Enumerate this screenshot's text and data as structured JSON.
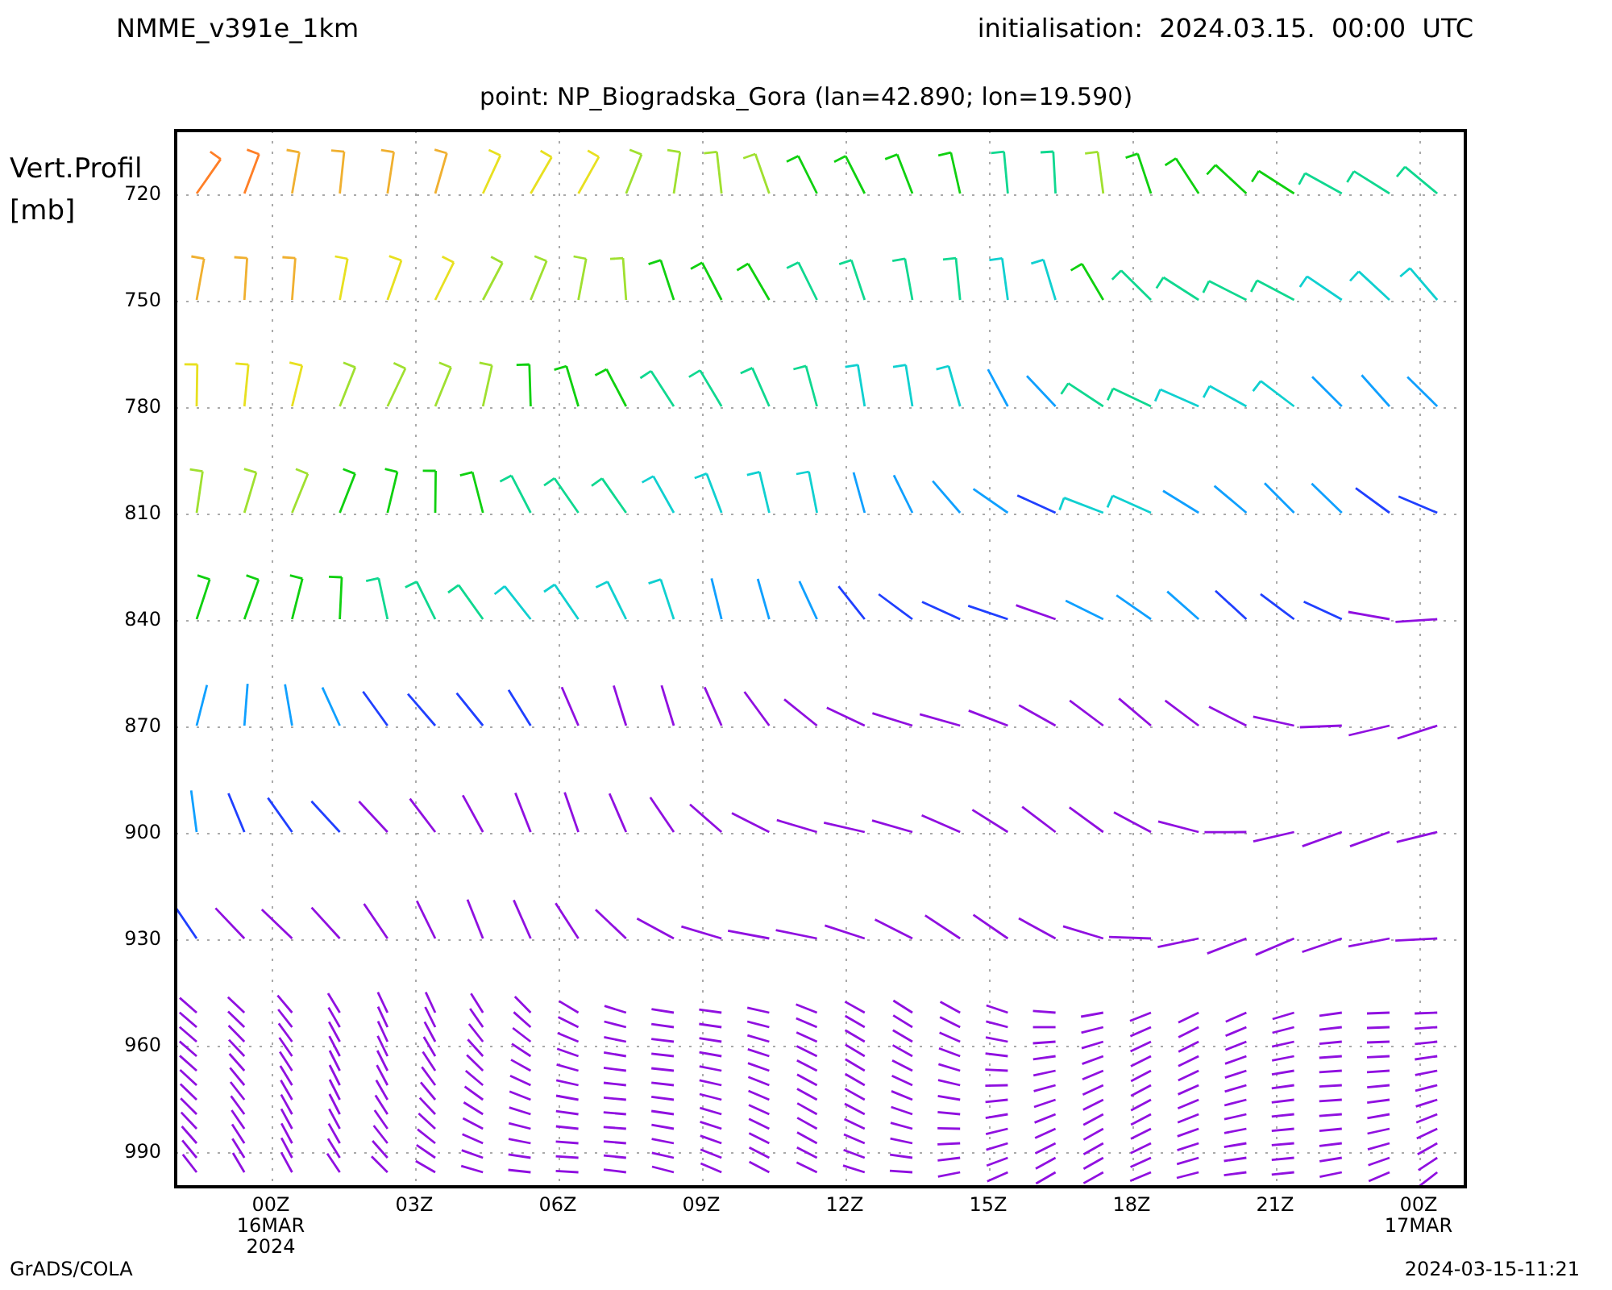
{
  "header": {
    "model": "NMME_v391e_1km",
    "initialisation": "initialisation:  2024.03.15.  00:00  UTC"
  },
  "subtitle": "point: NP_Biogradska_Gora (lan=42.890; lon=19.590)",
  "y_axis": {
    "title": "Vert.Profil",
    "unit": "[mb]",
    "ticks": [
      "720",
      "750",
      "780",
      "810",
      "840",
      "870",
      "900",
      "930",
      "960",
      "990"
    ]
  },
  "x_axis": {
    "ticks": [
      {
        "time": "00Z",
        "date": "16MAR",
        "year": "2024"
      },
      {
        "time": "03Z"
      },
      {
        "time": "06Z"
      },
      {
        "time": "09Z"
      },
      {
        "time": "12Z"
      },
      {
        "time": "15Z"
      },
      {
        "time": "18Z"
      },
      {
        "time": "21Z"
      },
      {
        "time": "00Z",
        "date": "17MAR"
      }
    ]
  },
  "footer": {
    "left": "GrADS/COLA",
    "right": "2024-03-15-11:21"
  }
}
